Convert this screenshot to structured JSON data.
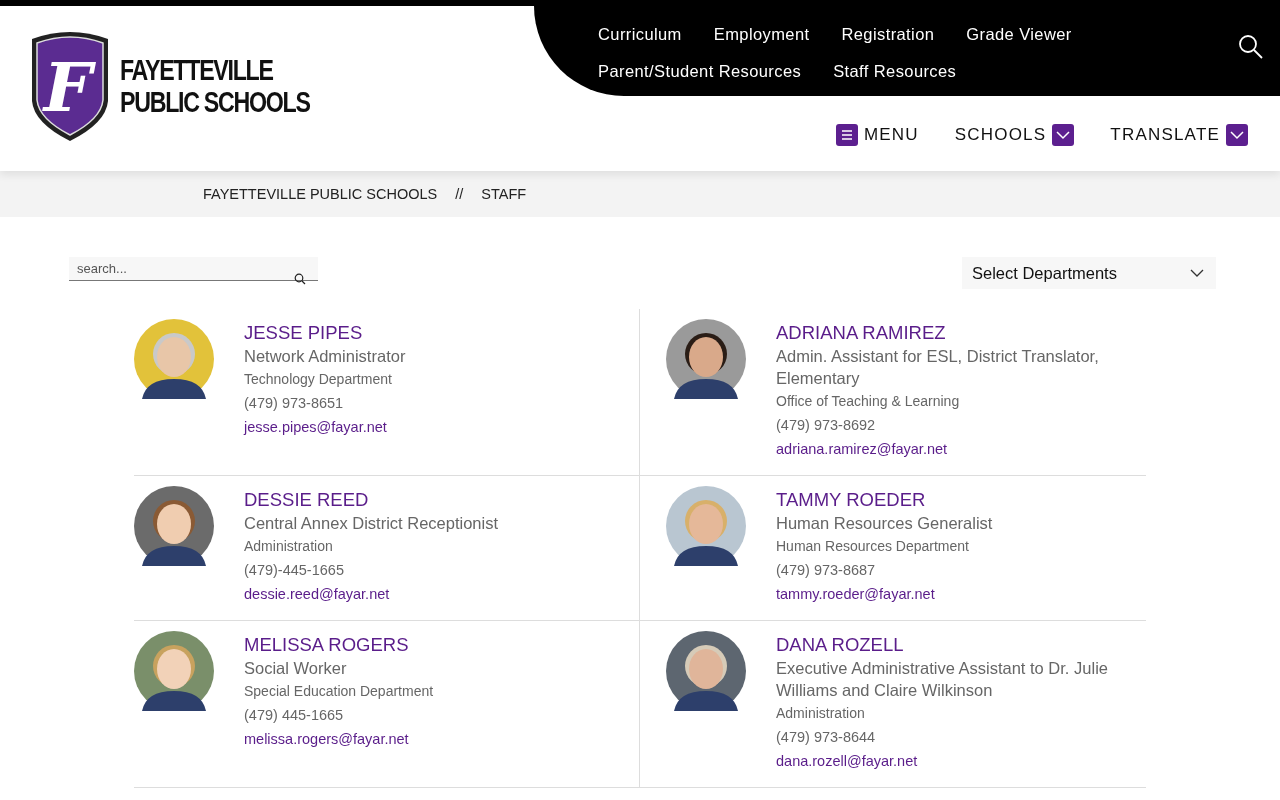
{
  "logo": {
    "letter": "F",
    "line1": "FAYETTEVILLE",
    "line2": "PUBLIC SCHOOLS"
  },
  "top_nav": {
    "links": [
      "Curriculum",
      "Employment",
      "Registration",
      "Grade Viewer",
      "Parent/Student Resources",
      "Staff Resources"
    ]
  },
  "utility_nav": [
    {
      "kind": "menu",
      "label": "MENU"
    },
    {
      "kind": "dropdown",
      "label": "SCHOOLS"
    },
    {
      "kind": "dropdown",
      "label": "TRANSLATE"
    }
  ],
  "breadcrumb": {
    "items": [
      "FAYETTEVILLE PUBLIC SCHOOLS",
      "STAFF"
    ],
    "separator": "//"
  },
  "search": {
    "placeholder": "search..."
  },
  "department_select": {
    "value": "Select Departments"
  },
  "staff": [
    {
      "name": "JESSE PIPES",
      "title": "Network Administrator",
      "department": "Technology Department",
      "phone": "(479) 973-8651",
      "email": "jesse.pipes@fayar.net"
    },
    {
      "name": "ADRIANA RAMIREZ",
      "title": "Admin. Assistant for ESL, District Translator, Elementary",
      "department": "Office of Teaching & Learning",
      "phone": "(479) 973-8692",
      "email": "adriana.ramirez@fayar.net"
    },
    {
      "name": "DESSIE REED",
      "title": "Central Annex District Receptionist",
      "department": "Administration",
      "phone": "(479)-445-1665",
      "email": "dessie.reed@fayar.net"
    },
    {
      "name": "TAMMY ROEDER",
      "title": "Human Resources Generalist",
      "department": "Human Resources Department",
      "phone": "(479) 973-8687",
      "email": "tammy.roeder@fayar.net"
    },
    {
      "name": "MELISSA ROGERS",
      "title": "Social Worker",
      "department": "Special Education Department",
      "phone": "(479) 445-1665",
      "email": "melissa.rogers@fayar.net"
    },
    {
      "name": "DANA ROZELL",
      "title": "Executive Administrative Assistant to Dr. Julie Williams and Claire Wilkinson",
      "department": "Administration",
      "phone": "(479) 973-8644",
      "email": "dana.rozell@fayar.net"
    }
  ]
}
